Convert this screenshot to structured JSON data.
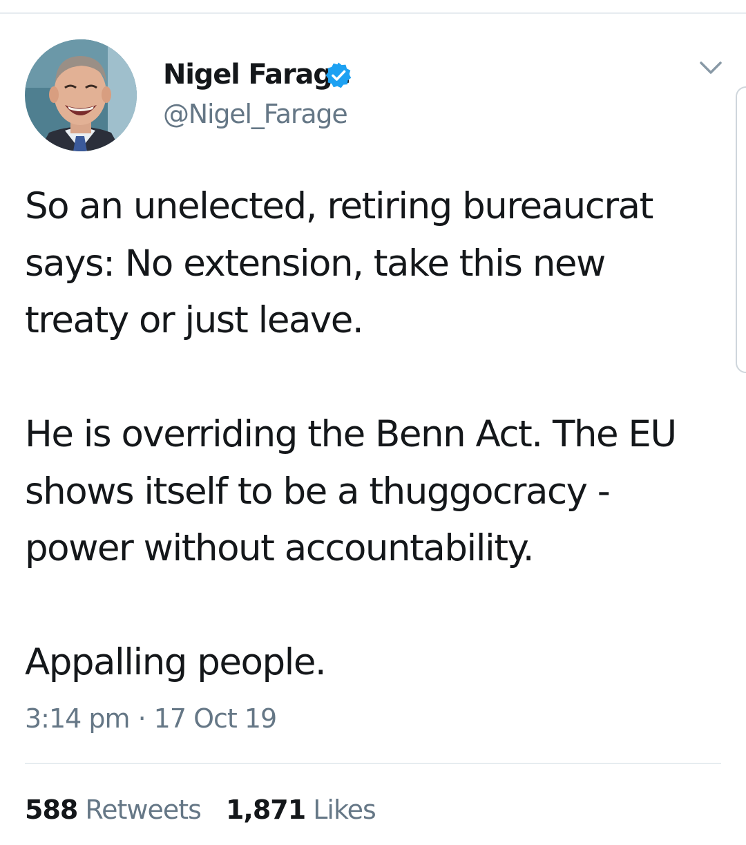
{
  "tweet": {
    "author": {
      "name": "Nigel Farage",
      "handle": "@Nigel_Farage",
      "verified": true
    },
    "text_paragraphs": [
      "So an unelected, retiring bureaucrat says: No extension, take this new treaty or just leave.",
      "He is overriding the Benn Act. The EU shows itself to be a thuggocracy - power without accountability.",
      "Appalling people."
    ],
    "time": "3:14 pm",
    "separator": "·",
    "date": "17 Oct 19",
    "stats": {
      "retweets_count": "588",
      "retweets_label": "Retweets",
      "likes_count": "1,871",
      "likes_label": "Likes"
    }
  },
  "icons": {
    "verified": "verified-badge-icon",
    "menu": "chevron-down-icon"
  },
  "colors": {
    "text": "#14171a",
    "secondary_text": "#657786",
    "verified_blue": "#1da1f2",
    "divider": "#e6ecf0"
  }
}
